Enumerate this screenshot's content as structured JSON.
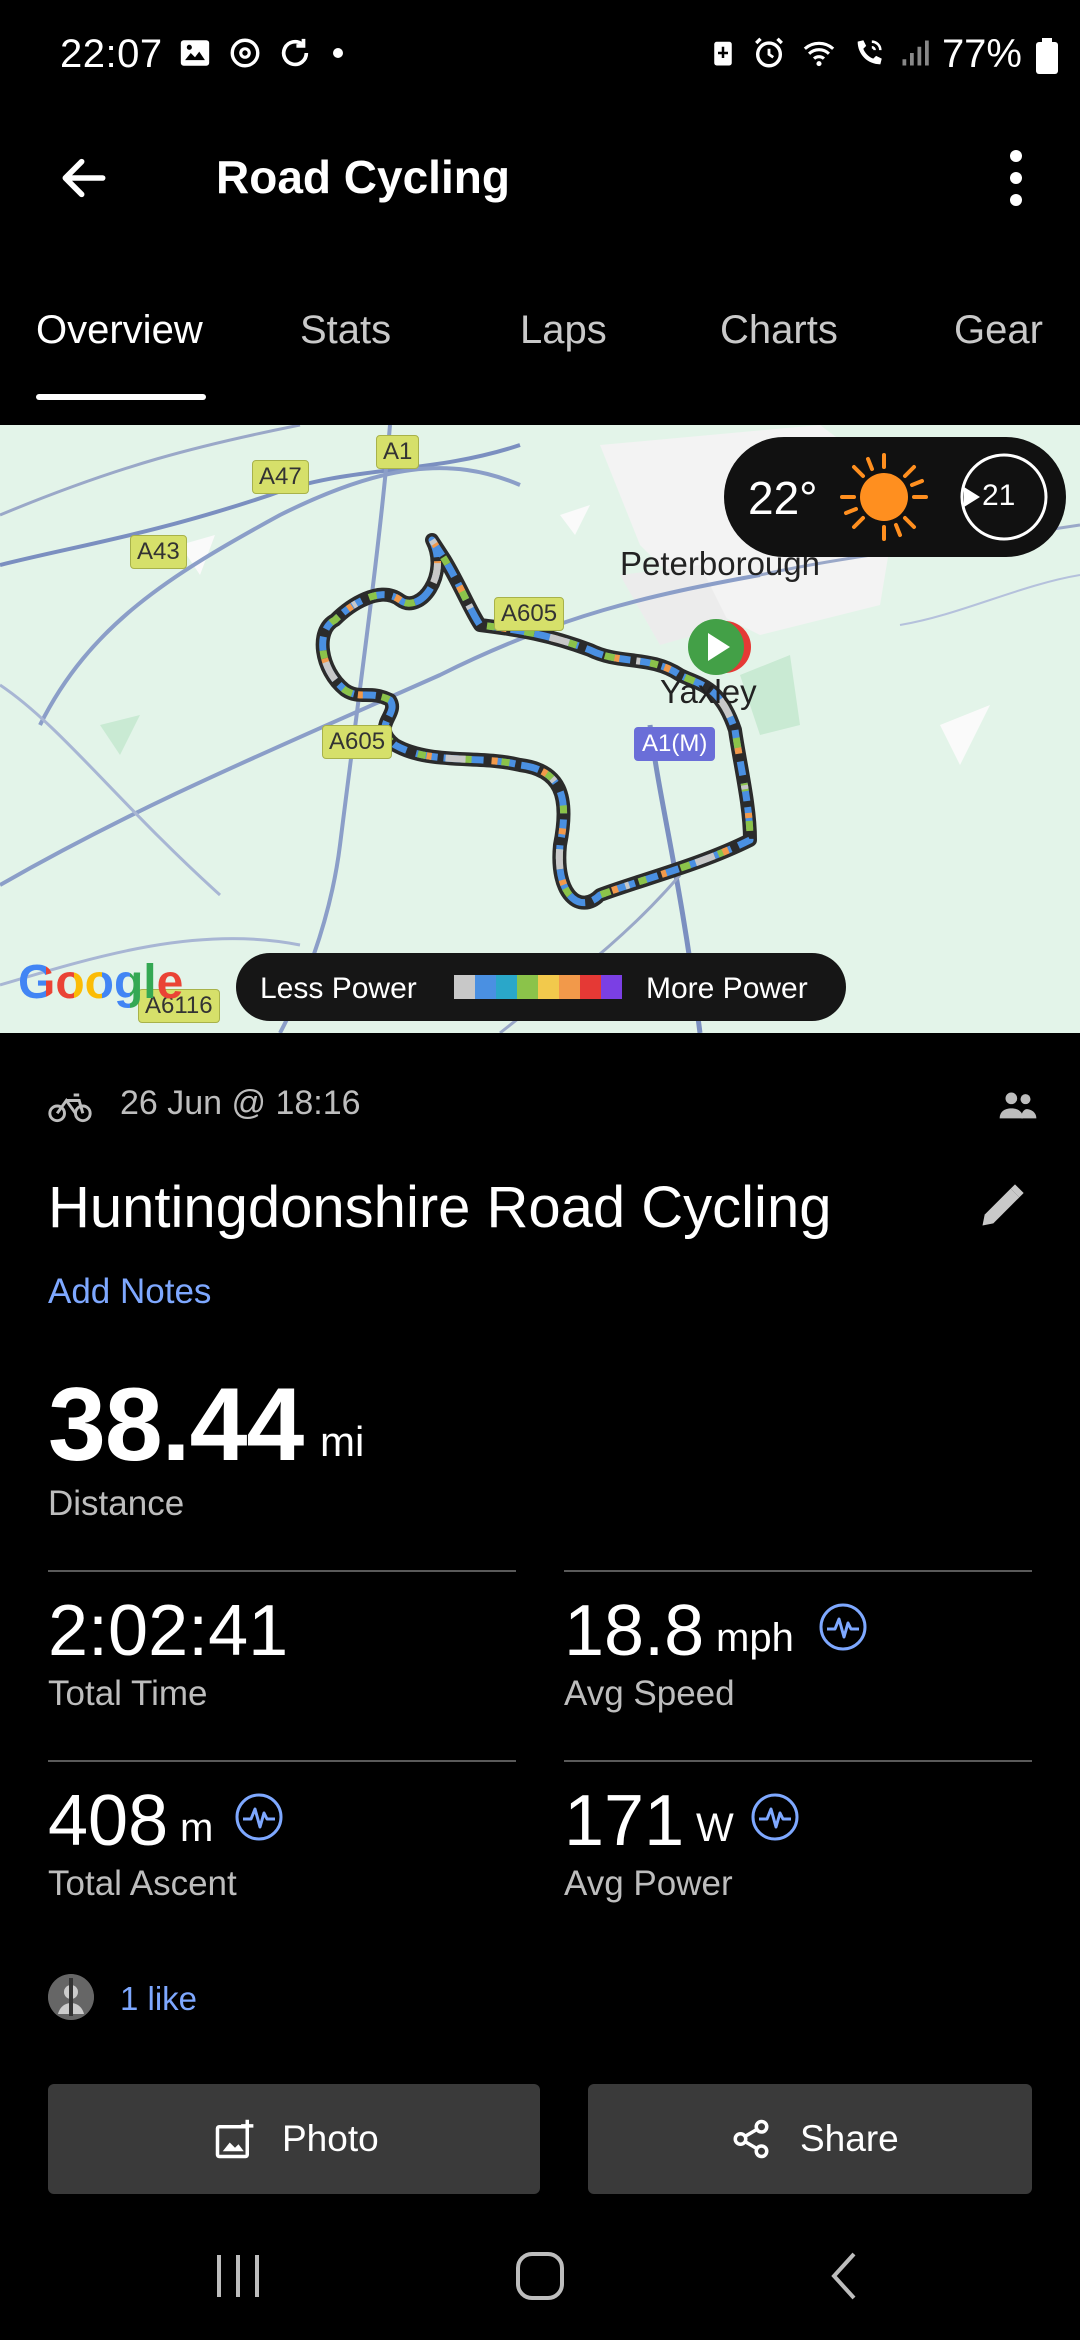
{
  "status_bar": {
    "time": "22:07",
    "battery": "77%",
    "left_icons": [
      "gallery-icon",
      "threads-icon",
      "sync-icon",
      "dot-icon"
    ],
    "right_icons": [
      "battery-saver-icon",
      "alarm-icon",
      "wifi-icon",
      "wifi-calling-icon",
      "signal-icon"
    ]
  },
  "app_bar": {
    "title": "Road Cycling",
    "back_icon": "arrow-left-icon",
    "more_icon": "more-vertical-icon"
  },
  "tabs": [
    "Overview",
    "Stats",
    "Laps",
    "Charts",
    "Gear"
  ],
  "active_tab": "Overview",
  "map": {
    "road_labels": [
      "A1",
      "A47",
      "A43",
      "A605",
      "A605",
      "A1(M)",
      "A6116"
    ],
    "place_labels": [
      "Peterborough",
      "Yaxley"
    ],
    "weather": {
      "temperature": "22°",
      "condition_icon": "sun-icon",
      "wind": "21"
    },
    "legend": {
      "less_label": "Less Power",
      "more_label": "More Power",
      "colors": [
        "#c8c8c8",
        "#4a90e2",
        "#2aa7c9",
        "#8bc34a",
        "#f2c94c",
        "#f2994a",
        "#e53935",
        "#7b3fe4"
      ]
    },
    "attribution": "Google"
  },
  "activity": {
    "date": "26 Jun @ 18:16",
    "title": "Huntingdonshire Road Cycling",
    "add_notes": "Add Notes",
    "distance": {
      "value": "38.44",
      "unit": "mi",
      "label": "Distance"
    },
    "stats": [
      {
        "value": "2:02:41",
        "unit": "",
        "label": "Total Time"
      },
      {
        "value": "18.8",
        "unit": "mph",
        "label": "Avg Speed"
      },
      {
        "value": "408",
        "unit": "m",
        "label": "Total Ascent"
      },
      {
        "value": "171",
        "unit": "W",
        "label": "Avg Power"
      }
    ],
    "likes": "1 like"
  },
  "actions": {
    "photo": "Photo",
    "share": "Share"
  },
  "accent_colors": {
    "link": "#7ea8ff",
    "route_outline": "#333333"
  }
}
